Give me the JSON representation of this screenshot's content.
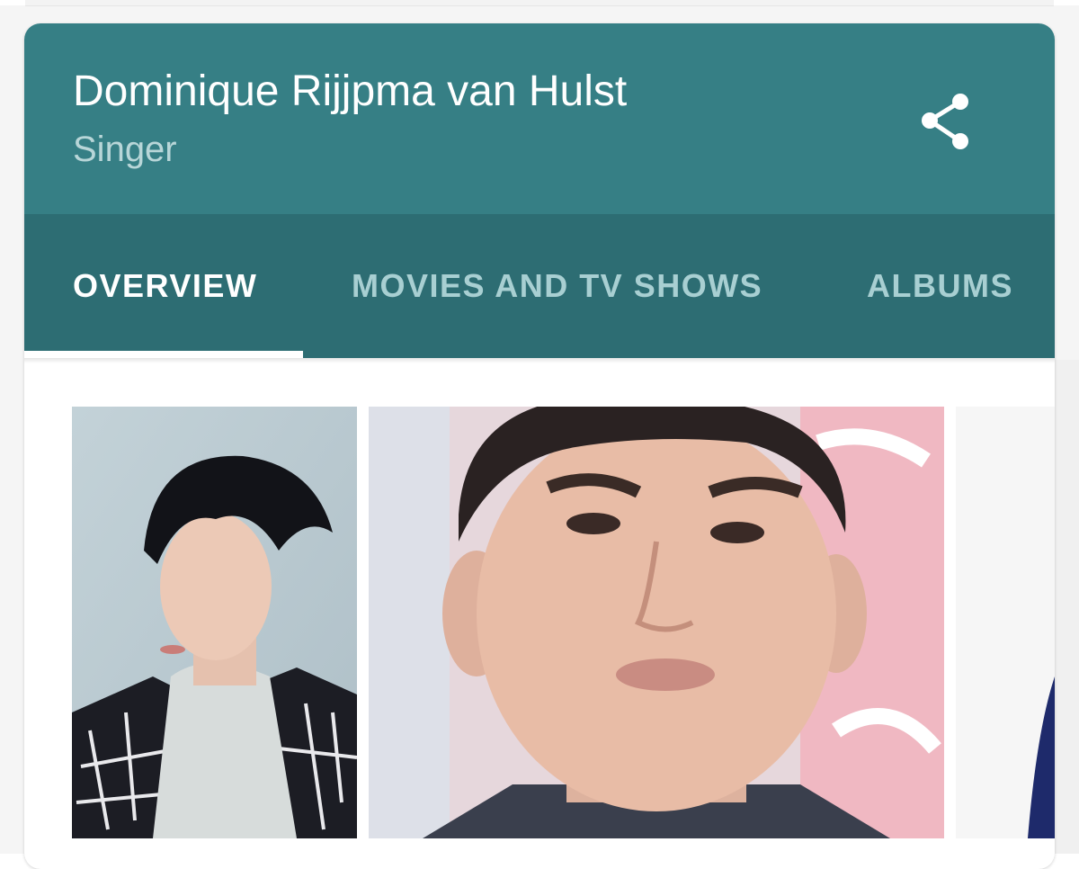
{
  "entity": {
    "name": "Dominique Rijjpma van Hulst",
    "category": "Singer",
    "share_icon": "share-icon"
  },
  "tabs": [
    {
      "label": "OVERVIEW",
      "active": true
    },
    {
      "label": "MOVIES AND TV SHOWS",
      "active": false
    },
    {
      "label": "ALBUMS",
      "active": false
    }
  ],
  "colors": {
    "header": "#367f85",
    "tab_bar": "#2d6d73",
    "tab_active": "#ffffff",
    "tab_inactive": "#a8cfd2",
    "subtitle": "#b8d6d8"
  },
  "images": [
    {
      "subject": "portrait-photo-1"
    },
    {
      "subject": "portrait-photo-2"
    },
    {
      "subject": "portrait-photo-3-partial"
    }
  ]
}
